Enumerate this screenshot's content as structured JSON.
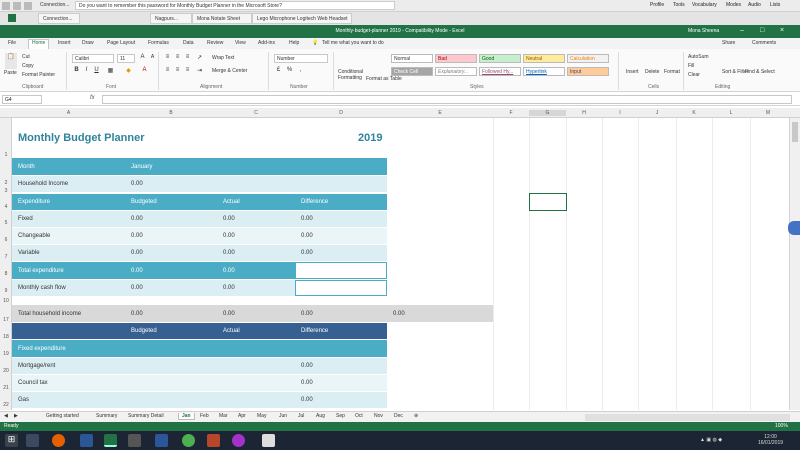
{
  "browser": {
    "url_bar_text": "Do you want to remember this password for Monthly Budget Planner in the Microsoft Store?",
    "menu": [
      "Profile",
      "Tools",
      "Vocabulary",
      "Modes",
      "Audio",
      "Lists"
    ],
    "tabs": [
      "Connection...",
      "Nagpurs...",
      "Mona Notate Sheet",
      "Lego Microphone Logitech Web Headset"
    ]
  },
  "excel": {
    "window_title": "Monthly-budget-planner 2019 - Compatibility Mode - Excel",
    "user": "Mona Sheena",
    "ribbon_tabs": [
      "File",
      "Home",
      "Insert",
      "Draw",
      "Page Layout",
      "Formulas",
      "Data",
      "Review",
      "View",
      "Add-ins",
      "Help"
    ],
    "active_tab": "Home",
    "tell_me": "Tell me what you want to do",
    "share": "Share",
    "comments": "Comments",
    "clipboard": {
      "cut": "Cut",
      "copy": "Copy",
      "format_painter": "Format Painter",
      "label": "Clipboard",
      "paste": "Paste"
    },
    "font": {
      "name": "Calibri",
      "size": "11",
      "label": "Font"
    },
    "alignment": {
      "wrap": "Wrap Text",
      "merge": "Merge & Center",
      "label": "Alignment"
    },
    "number": {
      "format": "Number",
      "label": "Number"
    },
    "styles": {
      "label": "Styles",
      "cond": "Conditional Formatting",
      "table": "Format as Table",
      "cells": [
        {
          "name": "Normal",
          "bg": "#ffffff",
          "fg": "#333333"
        },
        {
          "name": "Bad",
          "bg": "#ffc7ce",
          "fg": "#9c0006"
        },
        {
          "name": "Good",
          "bg": "#c6efce",
          "fg": "#006100"
        },
        {
          "name": "Neutral",
          "bg": "#ffeb9c",
          "fg": "#9c5700"
        },
        {
          "name": "Calculation",
          "bg": "#f2f2f2",
          "fg": "#fa7d00"
        },
        {
          "name": "Check Cell",
          "bg": "#a5a5a5",
          "fg": "#ffffff"
        },
        {
          "name": "Explanatory...",
          "bg": "#ffffff",
          "fg": "#7f7f7f"
        },
        {
          "name": "Followed Hy...",
          "bg": "#ffffff",
          "fg": "#954f72"
        },
        {
          "name": "Hyperlink",
          "bg": "#ffffff",
          "fg": "#0563c1"
        },
        {
          "name": "Input",
          "bg": "#ffcc99",
          "fg": "#3f3f76"
        }
      ]
    },
    "cells_group": {
      "insert": "Insert",
      "delete": "Delete",
      "format": "Format",
      "label": "Cells"
    },
    "editing": {
      "autosum": "AutoSum",
      "fill": "Fill",
      "clear": "Clear",
      "sort": "Sort & Filter",
      "find": "Find & Select",
      "label": "Editing"
    },
    "name_box": "G4",
    "fx": "fx",
    "columns": [
      "A",
      "B",
      "C",
      "D",
      "E",
      "F",
      "G",
      "H",
      "I",
      "J",
      "K",
      "L",
      "M"
    ],
    "rows": [
      "1",
      "2",
      "3",
      "4",
      "5",
      "6",
      "7",
      "8",
      "9",
      "10",
      "17",
      "18",
      "19",
      "20",
      "21",
      "22"
    ],
    "sheet": {
      "title": "Monthly Budget Planner",
      "year": "2019",
      "month_label": "Month",
      "month_value": "January",
      "household_income_label": "Household Income",
      "household_income_value": "0.00",
      "headers": [
        "Expenditure",
        "Budgeted",
        "Actual",
        "Difference"
      ],
      "rows": [
        {
          "label": "Fixed",
          "budgeted": "0.00",
          "actual": "0.00",
          "difference": "0.00"
        },
        {
          "label": "Changeable",
          "budgeted": "0.00",
          "actual": "0.00",
          "difference": "0.00"
        },
        {
          "label": "Variable",
          "budgeted": "0.00",
          "actual": "0.00",
          "difference": "0.00"
        }
      ],
      "total_expenditure": {
        "label": "Total expenditure",
        "budgeted": "0.00",
        "actual": "0.00"
      },
      "monthly_cash_flow": {
        "label": "Monthly cash flow",
        "budgeted": "0.00",
        "actual": "0.00"
      },
      "total_household": {
        "label": "Total household income",
        "b": "0.00",
        "c": "0.00",
        "d": "0.00",
        "e": "0.00"
      },
      "section2_headers": [
        "Budgeted",
        "Actual",
        "Difference"
      ],
      "fixed_expenditure": "Fixed expenditure",
      "fixed_rows": [
        {
          "label": "Mortgage/rent",
          "difference": "0.00"
        },
        {
          "label": "Council tax",
          "difference": "0.00"
        },
        {
          "label": "Gas",
          "difference": "0.00"
        }
      ]
    },
    "sheet_tabs": [
      "Getting started",
      "Summary",
      "Summary Detail",
      "Jan",
      "Feb",
      "Mar",
      "Apr",
      "May",
      "Jun",
      "Jul",
      "Aug",
      "Sep",
      "Oct",
      "Nov",
      "Dec"
    ],
    "active_sheet": "Jan",
    "status": {
      "left": "Ready",
      "zoom": "100%"
    }
  },
  "taskbar": {
    "time": "12:00",
    "date": "16/01/2019"
  }
}
